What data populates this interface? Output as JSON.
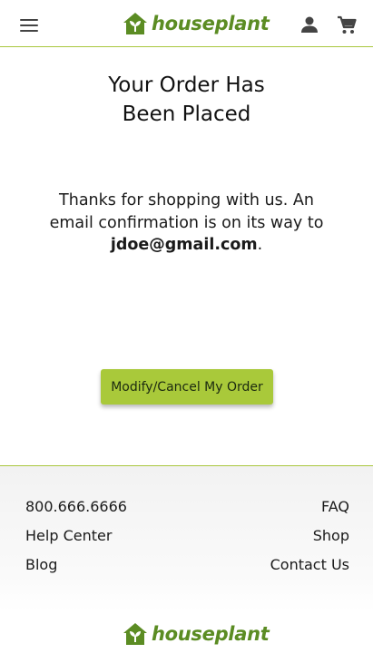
{
  "brand": {
    "name": "houseplant",
    "color": "#5b8c23",
    "accent": "#a9c93a"
  },
  "header": {
    "menu_icon": "menu-icon",
    "account_icon": "account-icon",
    "cart_icon": "cart-icon"
  },
  "confirmation": {
    "title_line1": "Your Order Has",
    "title_line2": "Been Placed",
    "message_prefix": "Thanks for shopping with us. An email confirmation is on its way to",
    "email": "jdoe@gmail.com",
    "message_suffix": ".",
    "button_label": "Modify/Cancel My Order"
  },
  "footer": {
    "left_links": [
      {
        "label": "800.666.6666"
      },
      {
        "label": "Help Center"
      },
      {
        "label": "Blog"
      }
    ],
    "right_links": [
      {
        "label": "FAQ"
      },
      {
        "label": "Shop"
      },
      {
        "label": "Contact Us"
      }
    ]
  }
}
